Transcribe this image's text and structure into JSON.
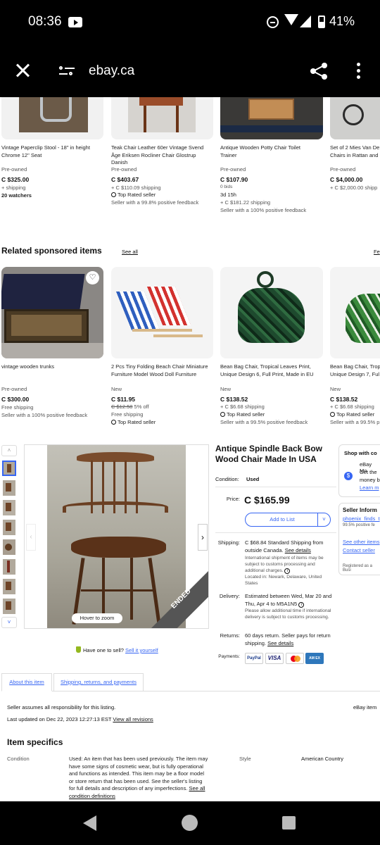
{
  "status": {
    "time": "08:36",
    "battery": "41%"
  },
  "browser": {
    "url": "ebay.ca"
  },
  "top_cards": [
    {
      "title": [
        "Vintage Paperclip Stool - 18\" in height",
        "Chrome 12\" Seat"
      ],
      "condition": "Pre-owned",
      "price": "C $325.00",
      "shipping": "+ shipping",
      "extra": "20 watchers"
    },
    {
      "title": [
        "Teak Chair Leather 60er Vintage Svend",
        "Åge Eriksen Rocliner Chair Glostrup",
        "Danish"
      ],
      "condition": "Pre-owned",
      "price": "C $403.67",
      "shipping": "+ C $110.09 shipping",
      "extra": "Top Rated seller",
      "extra2": "Seller with a 99.8% positive feedback"
    },
    {
      "title": [
        "Antique Wooden Potty Chair Toilet",
        "Trainer"
      ],
      "condition": "Pre-owned",
      "price": "C $107.90",
      "shipping": "0 bids",
      "extra": "3d 15h",
      "extra2": "+ C $181.22 shipping",
      "extra3": "Seller with a 100% positive feedback"
    },
    {
      "title": [
        "Set of 2 Mies Van De",
        "Chairs in Rattan and"
      ],
      "condition": "Pre-owned",
      "price": "C $4,000.00",
      "shipping": "+ C $2,000.00 shipp"
    }
  ],
  "related": {
    "heading": "Related sponsored items",
    "see_all": "See all",
    "right_link": "Fe"
  },
  "related_cards": [
    {
      "title": [
        "vintage wooden trunks"
      ],
      "condition": "Pre-owned",
      "price": "C $300.00",
      "line1": "Free shipping",
      "line2": "Seller with a 100% positive feedback"
    },
    {
      "title": [
        "2 Pcs Tiny Folding Beach Chair Miniature",
        "Furniture Model Wood Doll Furniture"
      ],
      "condition": "New",
      "price": "C $11.95",
      "old_price": "C $12.58",
      "pct": "5% off",
      "line1": "Free shipping",
      "line2": "Top Rated seller"
    },
    {
      "title": [
        "Bean Bag Chair, Tropical Leaves Print,",
        "Unique Design 6, Full Print, Made in EU"
      ],
      "condition": "New",
      "price": "C $138.52",
      "line1": "+ C $6.68 shipping",
      "line2": "Top Rated seller",
      "line3": "Seller with a 99.5% positive feedback"
    },
    {
      "title": [
        "Bean Bag Chair, Trop",
        "Unique Design 7, Ful"
      ],
      "condition": "New",
      "price": "C $138.52",
      "line1": "+ C $6.68 shipping",
      "line2": "Top Rated seller",
      "line3": "Seller with a 99.5% p"
    }
  ],
  "item": {
    "title": "Antique Spindle Back Bow Wood Chair Made In USA",
    "condition_label": "Condition:",
    "condition": "Used",
    "price_label": "Price:",
    "price": "C $165.99",
    "add_to_list": "Add to List",
    "shipping_label": "Shipping:",
    "shipping_main": "C $68.84 Standard Shipping from outside Canada.",
    "shipping_see": "See details",
    "shipping_note": "International shipment of items may be subject to customs processing and additional charges.",
    "location": "Located in: Newark, Delaware, United States",
    "delivery_label": "Delivery:",
    "delivery_main": "Estimated between Wed, Mar 20 and Thu, Apr 4 to M5A1N5",
    "delivery_note1": "Please allow additional time if international delivery is subject to customs processing.",
    "returns_label": "Returns:",
    "returns_main": "60 days return. Seller pays for return shipping.",
    "returns_see": "See details",
    "payments_label": "Payments:",
    "hover_zoom": "Hover to zoom",
    "ended": "ENDED",
    "sell_prompt": "Have one to sell?",
    "sell_link": "Sell it yourself"
  },
  "side": {
    "shop_title": "Shop with co",
    "ebay_money": "eBay Mo",
    "get_the": "Get the",
    "money_b": "money b",
    "learn": "Learn m",
    "seller_info": "Seller Inform",
    "seller_name": "phoenix_finds_t",
    "seller_fb": "99.5% positive fe",
    "see_other": "See other items",
    "contact": "Contact seller",
    "registered": "Registered as a Busi"
  },
  "tabs": {
    "about": "About this item",
    "shipping": "Shipping, returns, and payments"
  },
  "desc": {
    "seller_assumes": "Seller assumes all responsibility for this listing.",
    "item_num": "eBay item",
    "updated": "Last updated on Dec 22, 2023 12:27:13 EST",
    "view_rev": "View all revisions",
    "specifics": "Item specifics",
    "cond_label": "Condition",
    "cond_text": "Used: An item that has been used previously. The item may have some signs of cosmetic wear, but is fully operational and functions as intended. This item may be a floor model or store return that has been used. See the seller's listing for full details and description of any imperfections.",
    "cond_link": "See all condition definitions",
    "style_label": "Style",
    "style_val": "American Country"
  },
  "colors": {
    "ebay_blue": "#3665f3",
    "amex": "#2e77bb",
    "mc_red": "#eb001b",
    "mc_orange": "#f79e1b"
  }
}
